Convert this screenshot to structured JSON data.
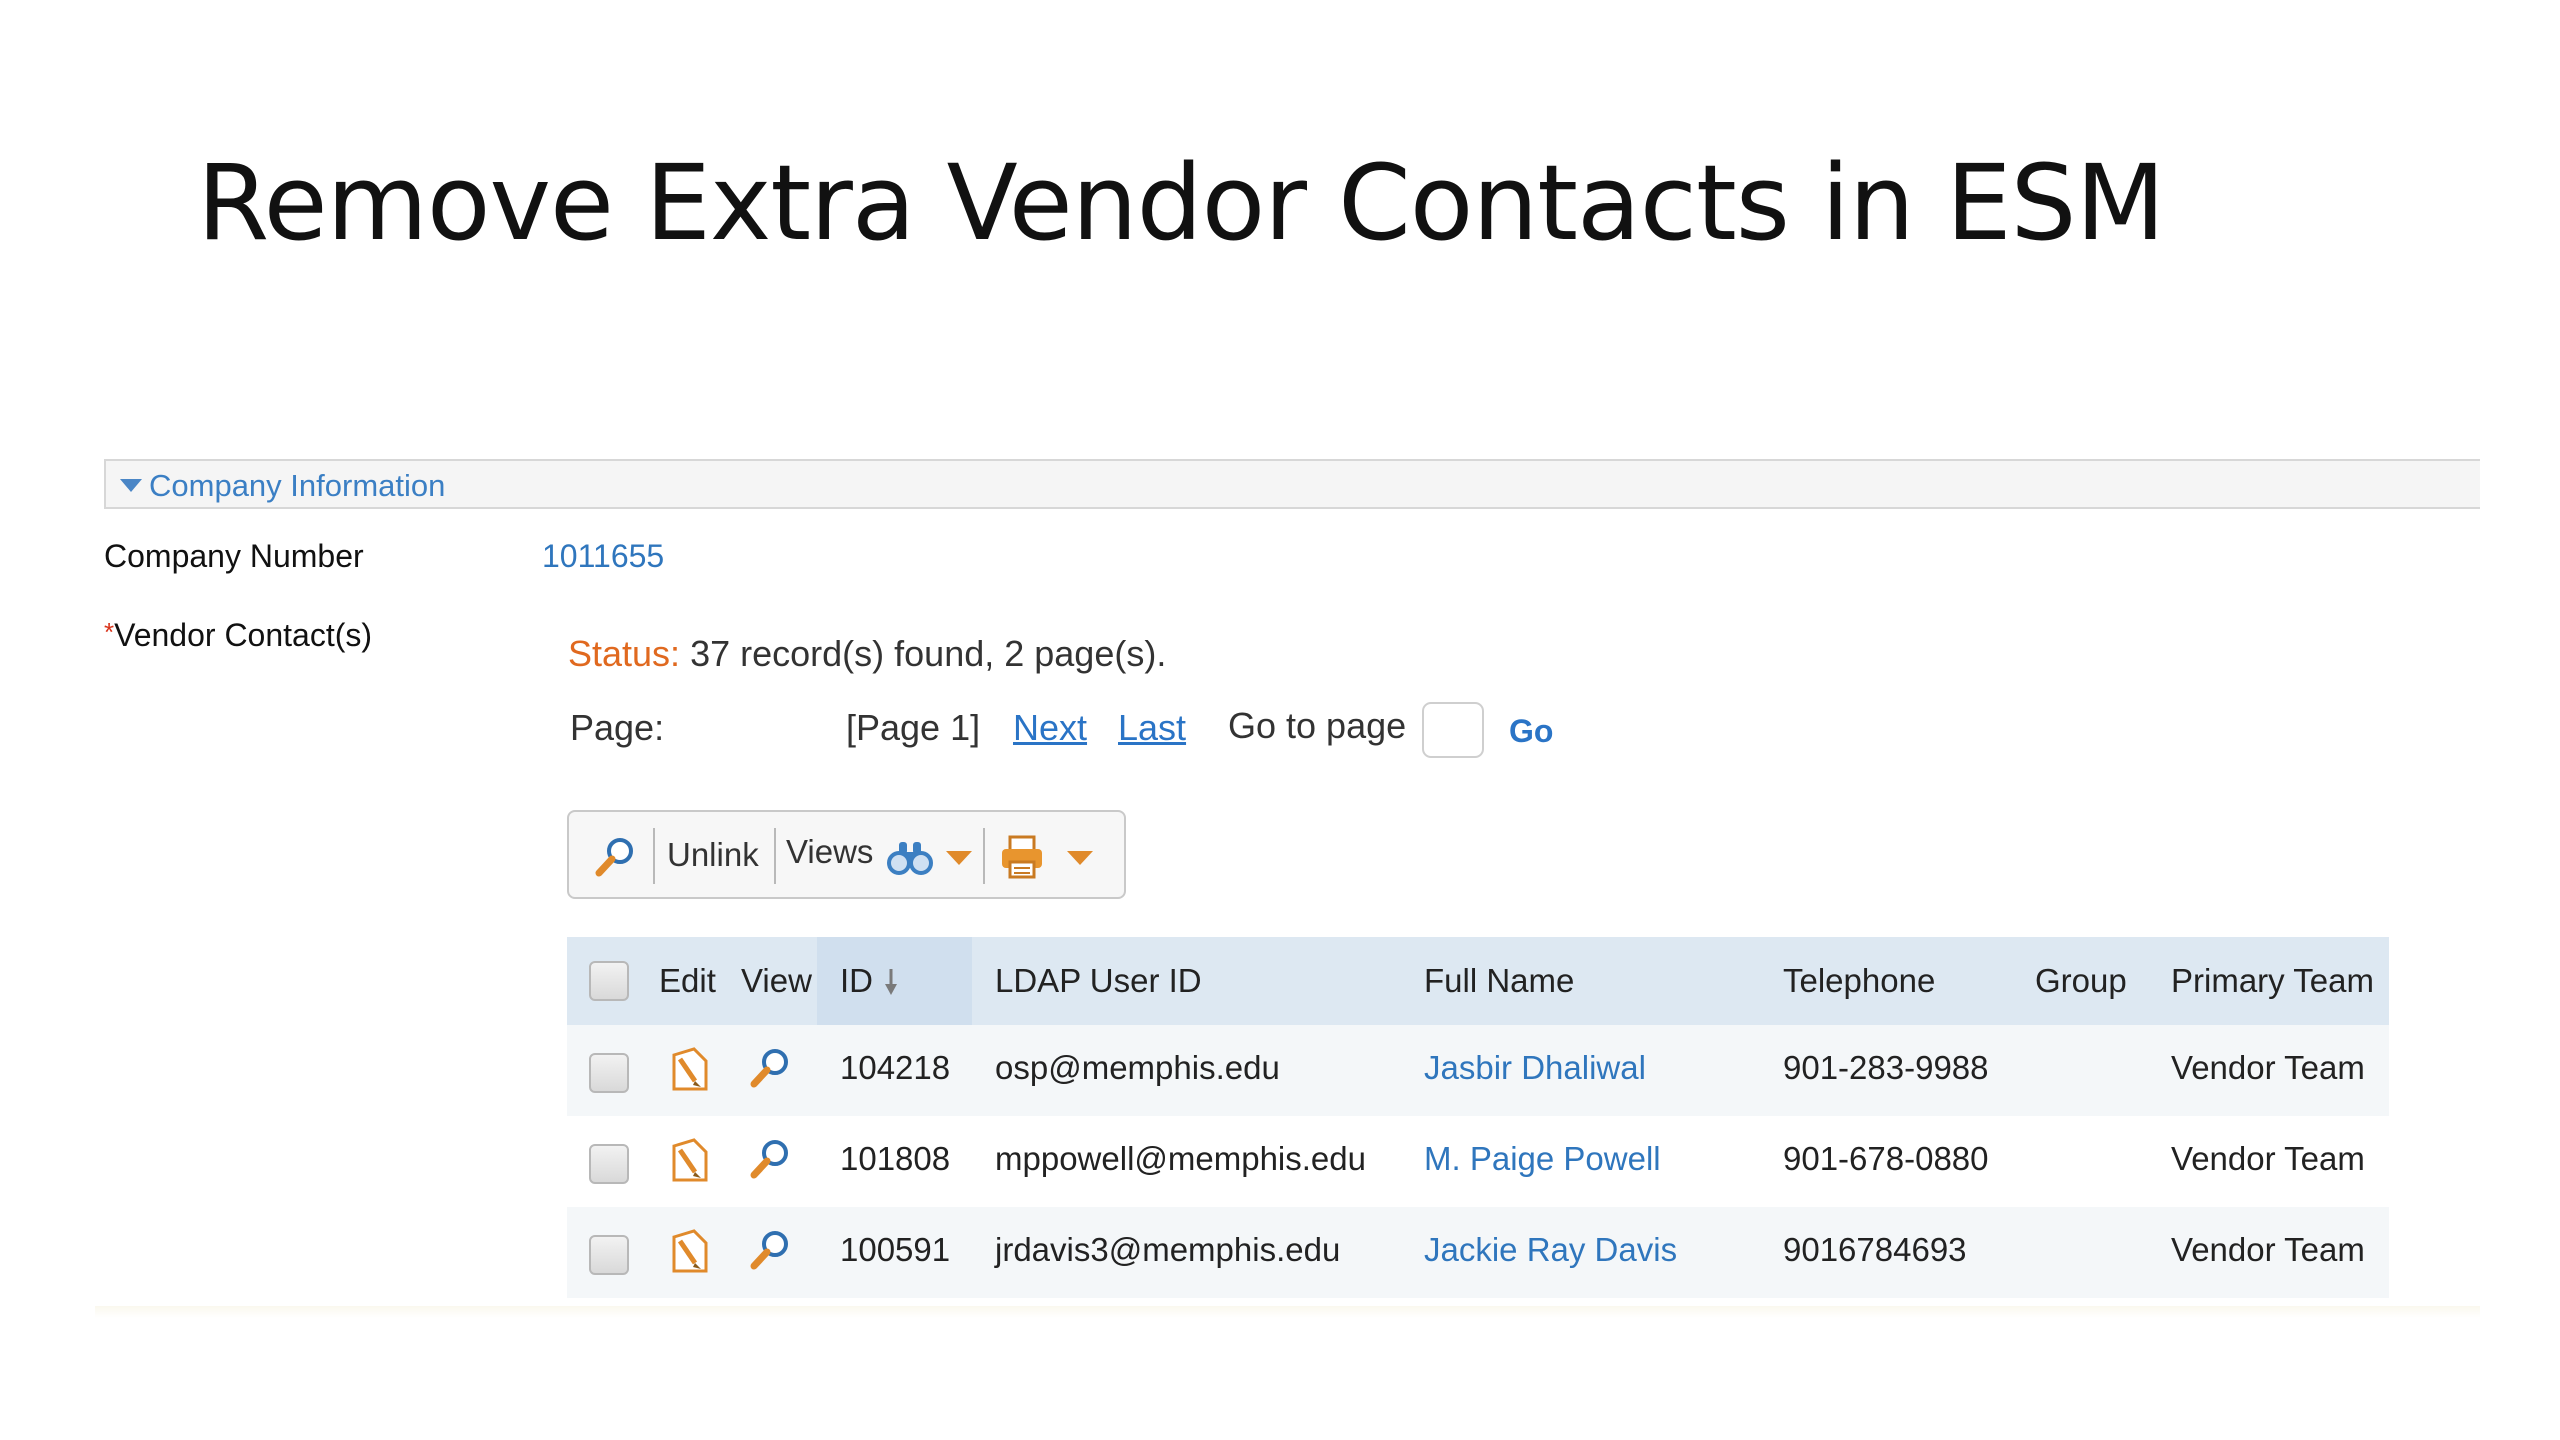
{
  "slide": {
    "title": "Remove Extra Vendor Contacts in ESM"
  },
  "panel": {
    "title": "Company Information"
  },
  "form": {
    "company_number_label": "Company Number",
    "company_number_value": "1011655",
    "required_marker": "*",
    "vendor_contacts_label": "Vendor Contact(s)"
  },
  "status": {
    "key": "Status:",
    "text": "37 record(s) found, 2 page(s)."
  },
  "pager": {
    "label": "Page:",
    "current": "[Page 1]",
    "next": "Next",
    "last": "Last",
    "goto_label": "Go to page",
    "goto_value": "",
    "go": "Go"
  },
  "toolbar": {
    "search_icon": "magnifier-icon",
    "unlink": "Unlink",
    "views": "Views",
    "views_icon": "binoculars-icon",
    "print_icon": "printer-icon"
  },
  "grid": {
    "columns": [
      "Edit",
      "View",
      "ID",
      "LDAP User ID",
      "Full Name",
      "Telephone",
      "Group",
      "Primary Team"
    ],
    "sorted_column": "ID",
    "sort_direction": "descending",
    "rows": [
      {
        "id": "104218",
        "ldap": "osp@memphis.edu",
        "name": "Jasbir Dhaliwal",
        "phone": "901-283-9988",
        "group": "",
        "team": "Vendor Team",
        "checked": false
      },
      {
        "id": "101808",
        "ldap": "mppowell@memphis.edu",
        "name": "M. Paige Powell",
        "phone": "901-678-0880",
        "group": "",
        "team": "Vendor Team",
        "checked": false
      },
      {
        "id": "100591",
        "ldap": "jrdavis3@memphis.edu",
        "name": "Jackie Ray Davis",
        "phone": "9016784693",
        "group": "",
        "team": "Vendor Team",
        "checked": false
      }
    ]
  },
  "colors": {
    "link": "#2f76bd",
    "status_key": "#e0691f",
    "header_bg": "#dde8f2",
    "icon_orange": "#e08a2b"
  }
}
